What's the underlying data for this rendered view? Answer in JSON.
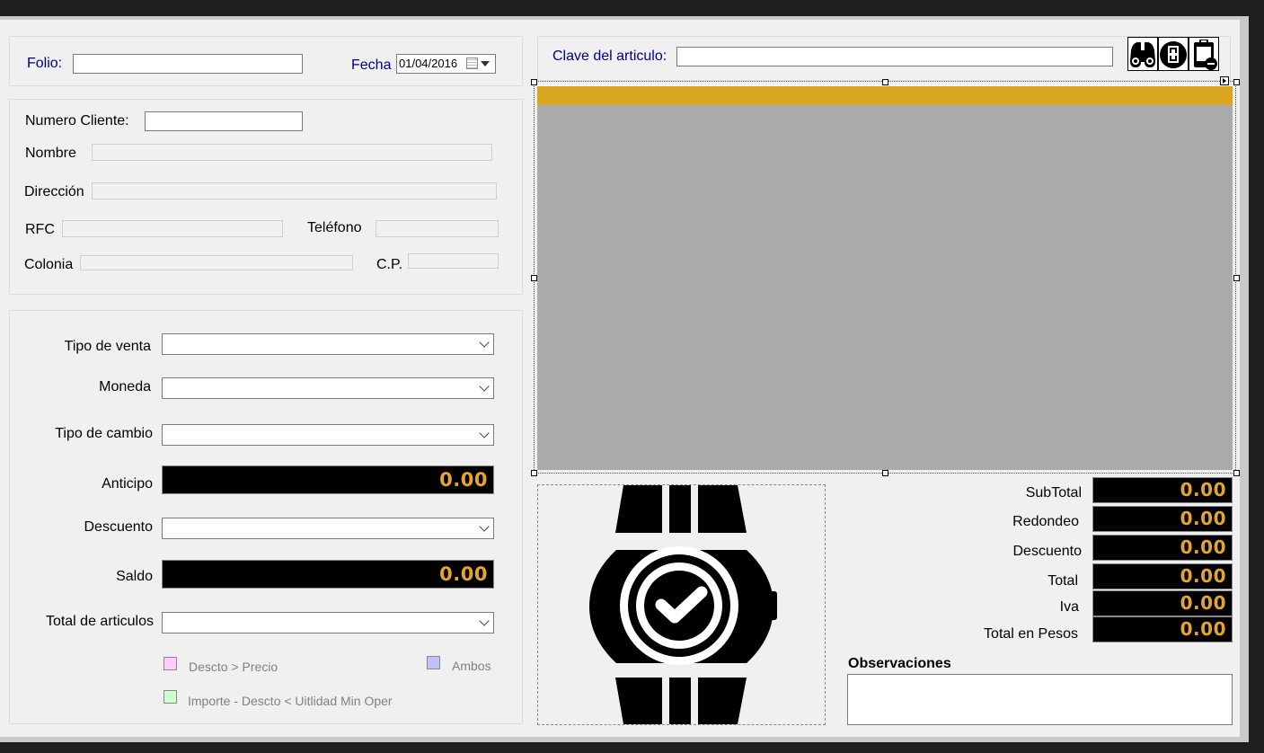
{
  "header": {
    "folio_label": "Folio:",
    "folio_value": "",
    "fecha_label": "Fecha",
    "fecha_value": "01/04/2016"
  },
  "cliente": {
    "numero_label": "Numero Cliente:",
    "numero_value": "",
    "nombre_label": "Nombre",
    "direccion_label": "Dirección",
    "rfc_label": "RFC",
    "telefono_label": "Teléfono",
    "colonia_label": "Colonia",
    "cp_label": "C.P."
  },
  "venta": {
    "tipo_venta_label": "Tipo de venta",
    "moneda_label": "Moneda",
    "tipo_cambio_label": "Tipo de cambio",
    "anticipo_label": "Anticipo",
    "anticipo_value": "0.00",
    "descuento_label": "Descuento",
    "saldo_label": "Saldo",
    "saldo_value": "0.00",
    "total_articulos_label": "Total de articulos"
  },
  "legend": {
    "descto_precio": "Descto > Precio",
    "ambos": "Ambos",
    "importe": "Importe - Descto < Uitlidad Min Oper",
    "colors": {
      "descto_precio": "#ffccff",
      "ambos": "#c0c0ff",
      "importe": "#ccffcc"
    }
  },
  "articulo": {
    "clave_label": "Clave del articulo:",
    "clave_value": "",
    "icons": [
      "binoculars-icon",
      "add-icon",
      "clipboard-remove-icon"
    ]
  },
  "grid": {
    "header_color": "#daa520",
    "body_color": "#ababab"
  },
  "totales": {
    "subtotal_label": "SubTotal",
    "subtotal_value": "0.00",
    "redondeo_label": "Redondeo",
    "redondeo_value": "0.00",
    "descuento_label": "Descuento",
    "descuento_value": "0.00",
    "total_label": "Total",
    "total_value": "0.00",
    "iva_label": "Iva",
    "iva_value": "0.00",
    "total_pesos_label": "Total en Pesos",
    "total_pesos_value": "0.00"
  },
  "observaciones": {
    "label": "Observaciones",
    "value": ""
  },
  "image": {
    "icon": "watch-icon"
  },
  "colors": {
    "accent_text": "#e8a52e",
    "title_text": "#000080"
  }
}
